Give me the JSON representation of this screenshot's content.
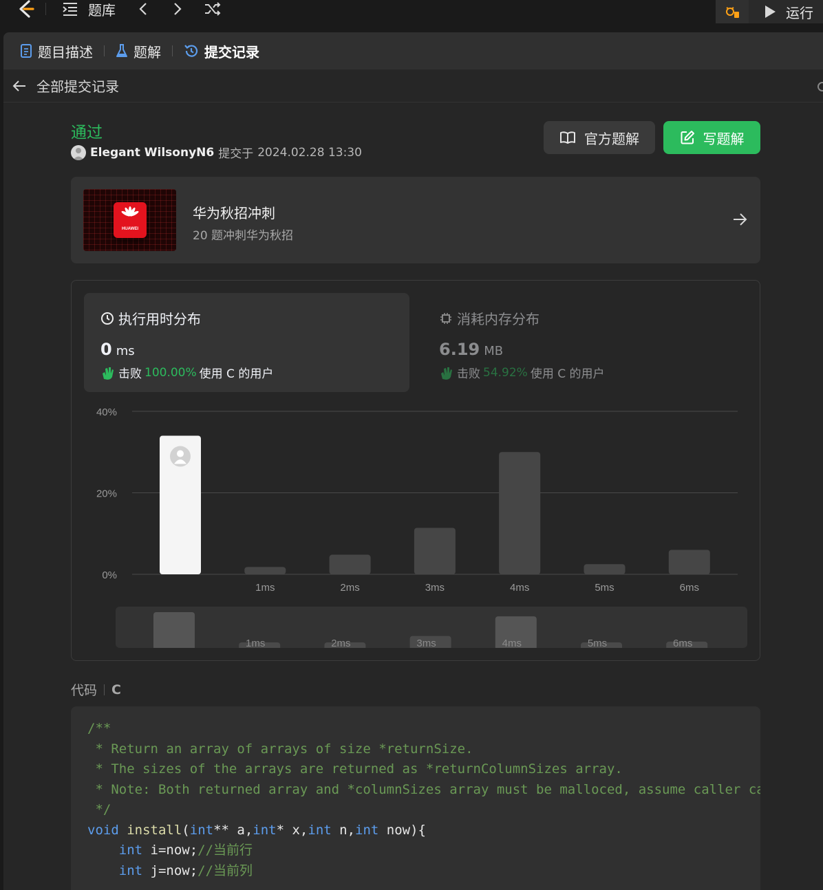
{
  "topbar": {
    "problems_label": "题库",
    "run_label": "运行"
  },
  "tabs": [
    {
      "label": "题目描述"
    },
    {
      "label": "题解"
    },
    {
      "label": "提交记录"
    }
  ],
  "back": {
    "label": "全部提交记录"
  },
  "submission": {
    "status": "通过",
    "user": "Elegant WilsonyN6",
    "submitted_prefix": "提交于",
    "submitted_at": "2024.02.28 13:30"
  },
  "buttons": {
    "official": "官方题解",
    "write": "写题解"
  },
  "promo": {
    "title": "华为秋招冲刺",
    "subtitle": "20 题冲刺华为秋招",
    "logo_text": "HUAWEI"
  },
  "runtime": {
    "title": "执行用时分布",
    "value": "0",
    "unit": "ms",
    "beat": "击败",
    "percent": "100.00%",
    "suffix": "使用 C 的用户"
  },
  "memory": {
    "title": "消耗内存分布",
    "value": "6.19",
    "unit": "MB",
    "beat": "击败",
    "percent": "54.92%",
    "suffix": "使用 C 的用户"
  },
  "chart_data": {
    "type": "bar",
    "categories": [
      "",
      "1ms",
      "2ms",
      "3ms",
      "4ms",
      "5ms",
      "6ms"
    ],
    "values": [
      34,
      1.8,
      4.8,
      11.4,
      30,
      2.5,
      6
    ],
    "highlight_index": 0,
    "y_ticks": [
      "0%",
      "20%",
      "40%"
    ],
    "ylim": [
      0,
      40
    ],
    "grid": true
  },
  "code_section": {
    "label": "代码",
    "lang": "C"
  },
  "colors": {
    "accent": "#2cbb5d",
    "bar": "#464646",
    "bar_highlight": "#f5f5f5"
  }
}
